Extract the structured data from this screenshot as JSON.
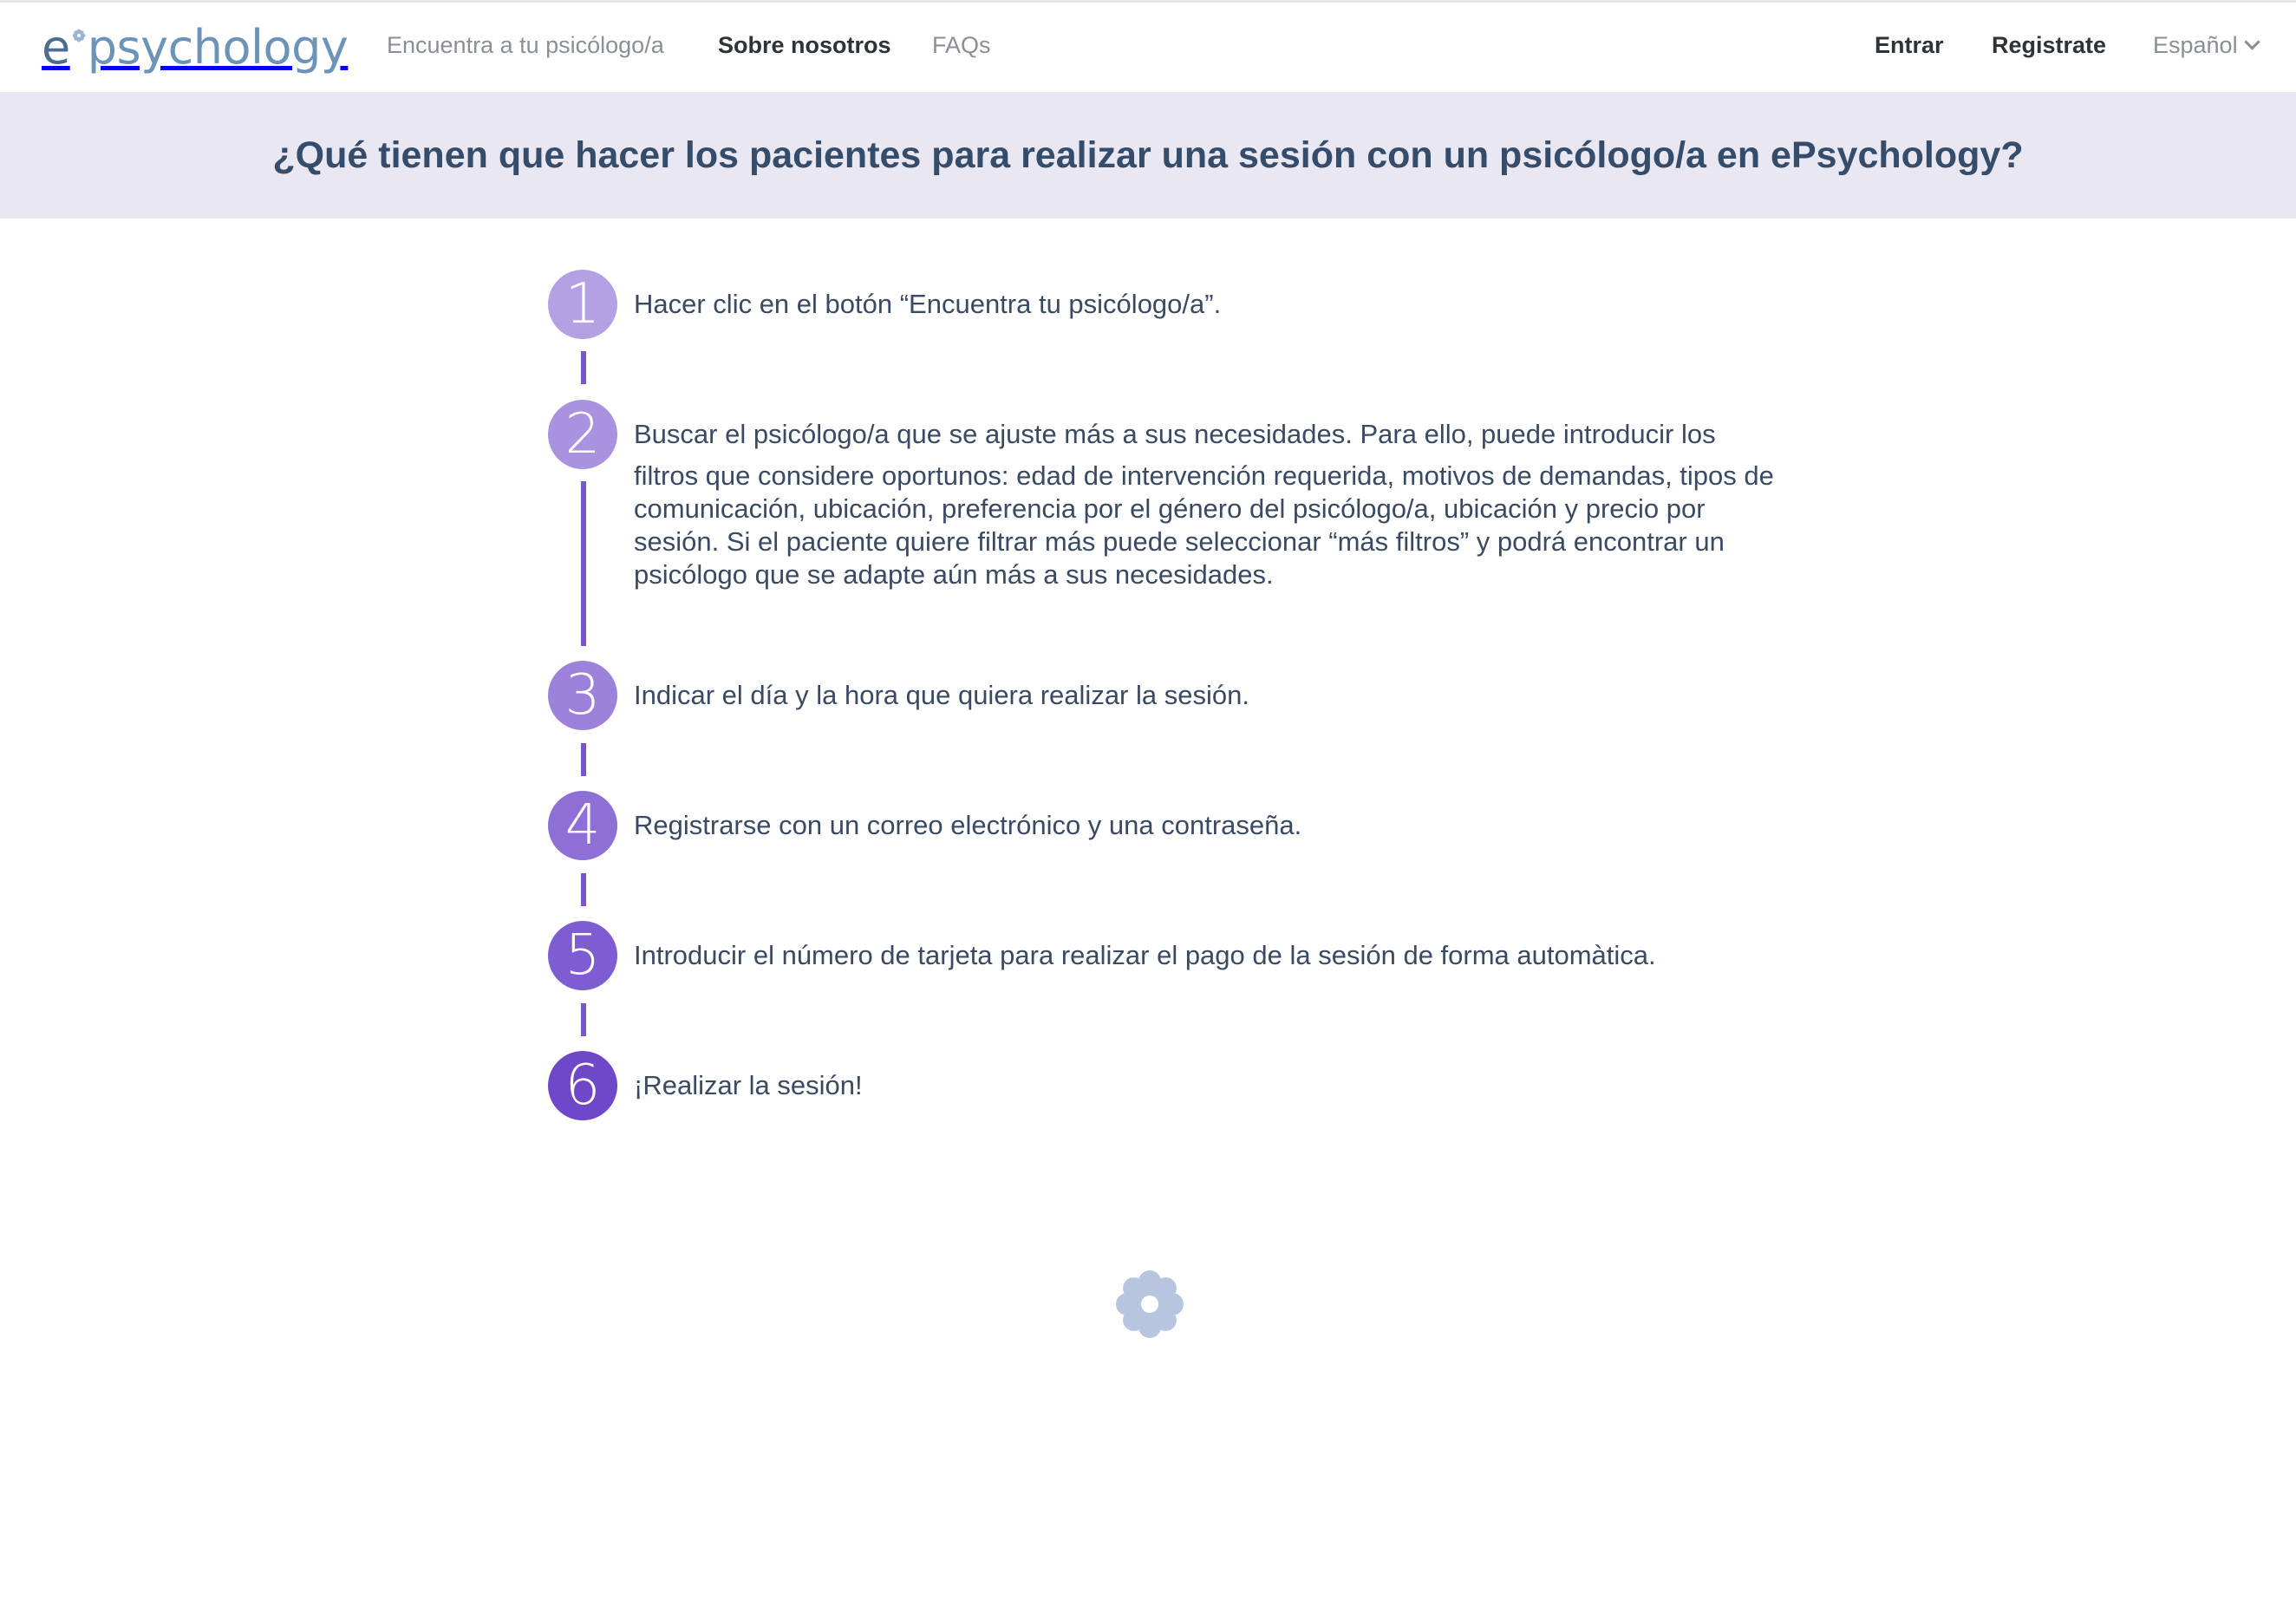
{
  "brand": {
    "logo_e": "e",
    "logo_rest": "psychology"
  },
  "nav": {
    "find_psychologist": "Encuentra a tu psicólogo/a",
    "about_us": "Sobre nosotros",
    "faqs": "FAQs",
    "login": "Entrar",
    "register": "Registrate",
    "language": "Español"
  },
  "hero": {
    "title": "¿Qué tienen que hacer los pacientes para realizar una sesión con un psicólogo/a en ePsychology?"
  },
  "steps": [
    {
      "number": "1",
      "text": "Hacer clic en el botón “Encuentra tu psicólogo/a”.",
      "color": "#b4a1e4"
    },
    {
      "number": "2",
      "text_first": "Buscar el psicólogo/a que se ajuste más a sus necesidades. Para ello, puede introducir los",
      "text_rest": "filtros que considere oportunos: edad de intervención requerida, motivos de demandas, tipos de comunicación, ubicación, preferencia por el género del psicólogo/a, ubicación y precio por sesión. Si el paciente quiere filtrar más puede seleccionar “más filtros” y podrá encontrar un psicólogo que se adapte aún más a sus necesidades.",
      "color": "#a993e0"
    },
    {
      "number": "3",
      "text": "Indicar el día y la hora que quiera realizar la sesión.",
      "color": "#9c82da"
    },
    {
      "number": "4",
      "text": "Registrarse con un correo electrónico y una contraseña.",
      "color": "#8d6fd6"
    },
    {
      "number": "5",
      "text": "Introducir el número de tarjeta para realizar el pago de la sesión de forma automàtica.",
      "color": "#7e5dd2"
    },
    {
      "number": "6",
      "text": "¡Realizar la sesión!",
      "color": "#6e48c8"
    }
  ],
  "colors": {
    "connector": "#7a55d0",
    "hero_background": "#e9e7f2",
    "hero_text": "#354d6b",
    "footer_icon": "#b7c6de"
  },
  "icons": {
    "logo_flower": "flower-icon",
    "language_chevron": "chevron-down-icon",
    "footer_flower": "flower-icon"
  }
}
